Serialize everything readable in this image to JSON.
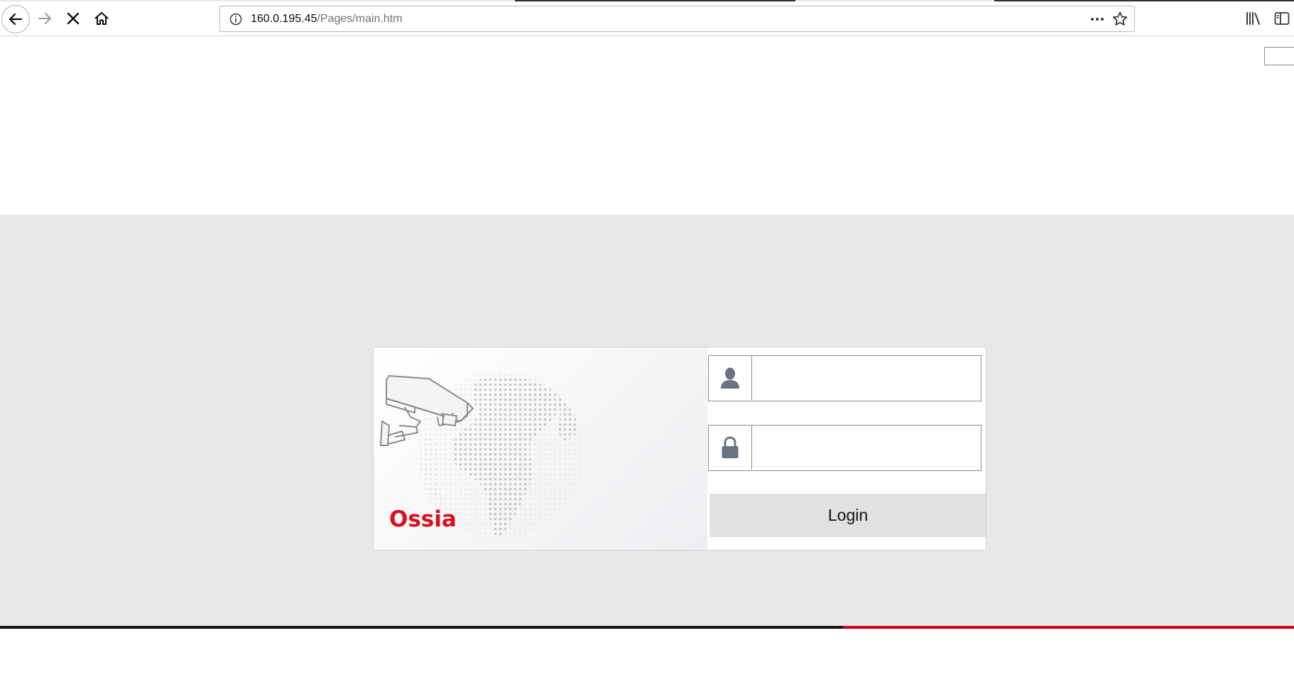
{
  "browser": {
    "url_host": "160.0.195.45",
    "url_path": "/Pages/main.htm",
    "icons": {
      "back": "back-arrow-icon",
      "forward": "forward-arrow-icon",
      "stop": "stop-x-icon",
      "home": "home-icon",
      "site_info": "info-icon",
      "page_actions": "more-dots-icon",
      "bookmark": "star-icon",
      "library": "library-icon",
      "sidebar": "sidebar-icon"
    }
  },
  "login": {
    "brand_name": "Ossia",
    "brand_color": "#d9101e",
    "username_value": "",
    "password_value": "",
    "login_label": "Login",
    "icons": {
      "user": "user-icon",
      "lock": "lock-icon",
      "camera": "security-camera-icon",
      "globe": "dotted-globe-icon"
    }
  },
  "colors": {
    "band_background": "#e8e8e8",
    "footer_line_left": "#111111",
    "footer_line_right": "#d7000f",
    "button_background": "#e1e1e1"
  }
}
